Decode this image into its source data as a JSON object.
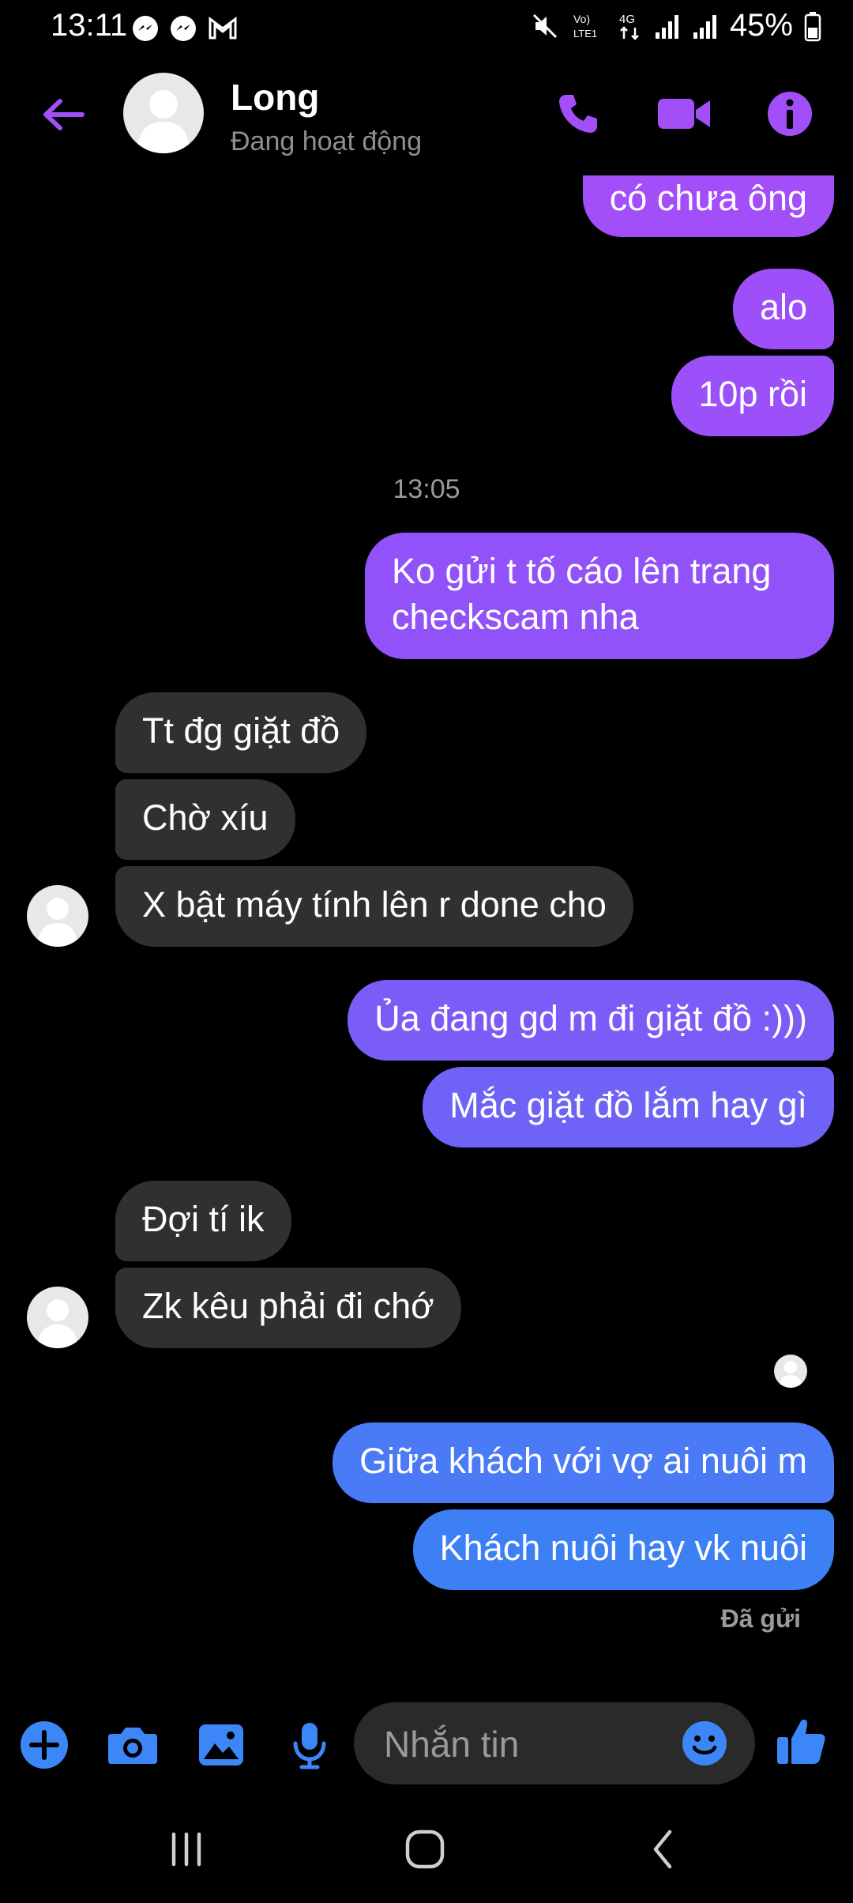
{
  "status_bar": {
    "time": "13:11",
    "battery": "45%"
  },
  "header": {
    "name": "Long",
    "status": "Đang hoạt động"
  },
  "messages": [
    {
      "text": "có chưa ông"
    },
    {
      "text": "alo"
    },
    {
      "text": "10p rồi"
    },
    {
      "text": "13:05"
    },
    {
      "text": "Ko gửi t tố cáo lên trang",
      "text2": "checkscam nha"
    },
    {
      "text": "Tt đg giặt đồ"
    },
    {
      "text": "Chờ xíu"
    },
    {
      "text": "X bật máy tính lên r done cho"
    },
    {
      "text": "Ủa đang gd m đi giặt đồ :)))"
    },
    {
      "text": "Mắc giặt đồ lắm hay gì"
    },
    {
      "text": "Đợi tí ik"
    },
    {
      "text": "Zk kêu phải đi chớ"
    },
    {
      "text": "Giữa khách với vợ ai nuôi m"
    },
    {
      "text": "Khách nuôi hay vk nuôi"
    }
  ],
  "sent_status": "Đã gửi",
  "composer": {
    "placeholder": "Nhắn tin"
  },
  "colors": {
    "accent": "#9b4dff",
    "in_bubble": "#303030",
    "out_top": "#a24ef9",
    "out_bottom": "#3c7ef5"
  }
}
